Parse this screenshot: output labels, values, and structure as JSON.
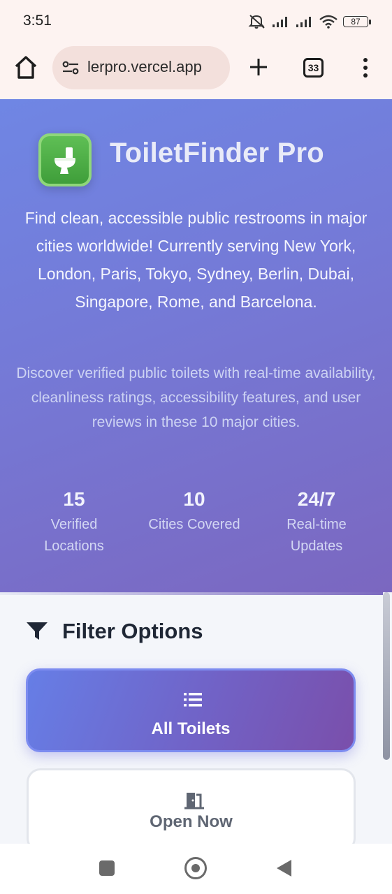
{
  "status_bar": {
    "time": "3:51",
    "battery": "87",
    "icons": [
      "mute-icon",
      "signal-icon",
      "signal-icon",
      "wifi-icon",
      "battery-icon"
    ]
  },
  "browser": {
    "url": "lerpro.vercel.app",
    "tab_count": "33",
    "icons": [
      "home-icon",
      "site-settings-icon",
      "plus-icon",
      "tabs-icon",
      "more-vert-icon"
    ]
  },
  "hero": {
    "icon": "toilet-icon",
    "title": "ToiletFinder Pro",
    "description": "Find clean, accessible public restrooms in major cities worldwide! Currently serving New York, London, Paris, Tokyo, Sydney, Berlin, Dubai, Singapore, Rome, and Barcelona.",
    "subtext": "Discover verified public toilets with real-time availability, cleanliness ratings, accessibility features, and user reviews in these 10 major cities.",
    "stats": [
      {
        "value": "15",
        "label": "Verified Locations"
      },
      {
        "value": "10",
        "label": "Cities Covered"
      },
      {
        "value": "24/7",
        "label": "Real-time Updates"
      }
    ]
  },
  "filters": {
    "title": "Filter Options",
    "icon": "filter-icon",
    "options": [
      {
        "label": "All Toilets",
        "icon": "list-icon",
        "active": true
      },
      {
        "label": "Open Now",
        "icon": "door-open-icon",
        "active": false
      }
    ]
  },
  "colors": {
    "hero_start": "#6f86e4",
    "hero_end": "#7b67c0",
    "active_button_start": "#667ee6",
    "active_button_end": "#7a4fab",
    "app_icon_green": "#4caf50"
  },
  "nav_bar": {
    "icons": [
      "recents-icon",
      "home-circle-icon",
      "back-icon"
    ]
  }
}
